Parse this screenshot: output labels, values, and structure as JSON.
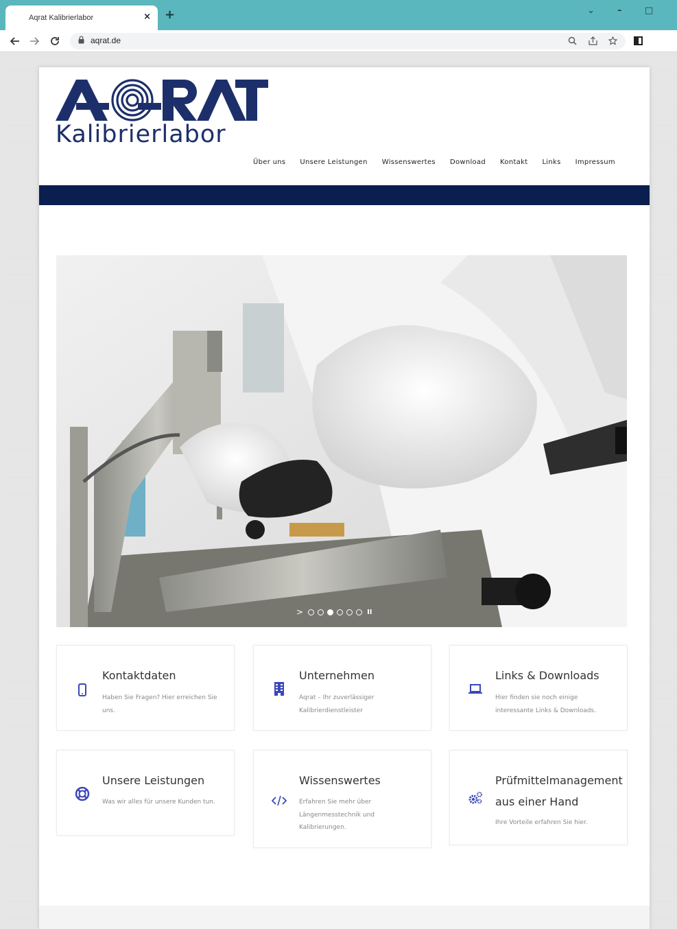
{
  "browser": {
    "tab_title": "Aqrat Kalibrierlabor",
    "tab_close": "×",
    "new_tab": "+",
    "url": "aqrat.de",
    "window_minimize": "–",
    "window_maximize": "□",
    "window_dropdown": "⌄",
    "icons": [
      "back-icon",
      "forward-icon",
      "reload-icon",
      "lock-icon",
      "zoom-icon",
      "share-icon",
      "bookmark-star-icon",
      "extension-icon"
    ]
  },
  "site": {
    "logo_main": "AQRAT",
    "logo_sub": "Kalibrierlabor",
    "nav": [
      "Über uns",
      "Unsere Leistungen",
      "Wissenswertes",
      "Download",
      "Kontakt",
      "Links",
      "Impressum"
    ],
    "slider": {
      "dot_count": 6,
      "active_dot": 3
    },
    "features": [
      {
        "title": "Kontaktdaten",
        "text": "Haben Sie Fragen? Hier erreichen Sie uns.",
        "icon": "mobile-phone-icon"
      },
      {
        "title": "Unternehmen",
        "text": "Aqrat – Ihr zuverlässiger Kalibrierdienstleister",
        "icon": "building-icon"
      },
      {
        "title": "Links & Downloads",
        "text": "Hier finden sie noch einige interessante Links & Downloads.",
        "icon": "laptop-icon"
      },
      {
        "title": "Unsere Leistungen",
        "text": "Was wir alles für unsere Kunden tun.",
        "icon": "lifebuoy-icon"
      },
      {
        "title": "Wissenswertes",
        "text": "Erfahren Sie mehr über Längenmesstechnik und Kalibrierungen.",
        "icon": "code-icon"
      },
      {
        "title": "Prüfmittelmanagement aus einer Hand",
        "text": "Ihre Vorteile erfahren Sie hier.",
        "icon": "gears-icon"
      }
    ],
    "colors": {
      "brand_navy": "#0a1f4f",
      "icon_blue": "#3b46b8",
      "chrome_teal": "#5ab7bd"
    }
  }
}
